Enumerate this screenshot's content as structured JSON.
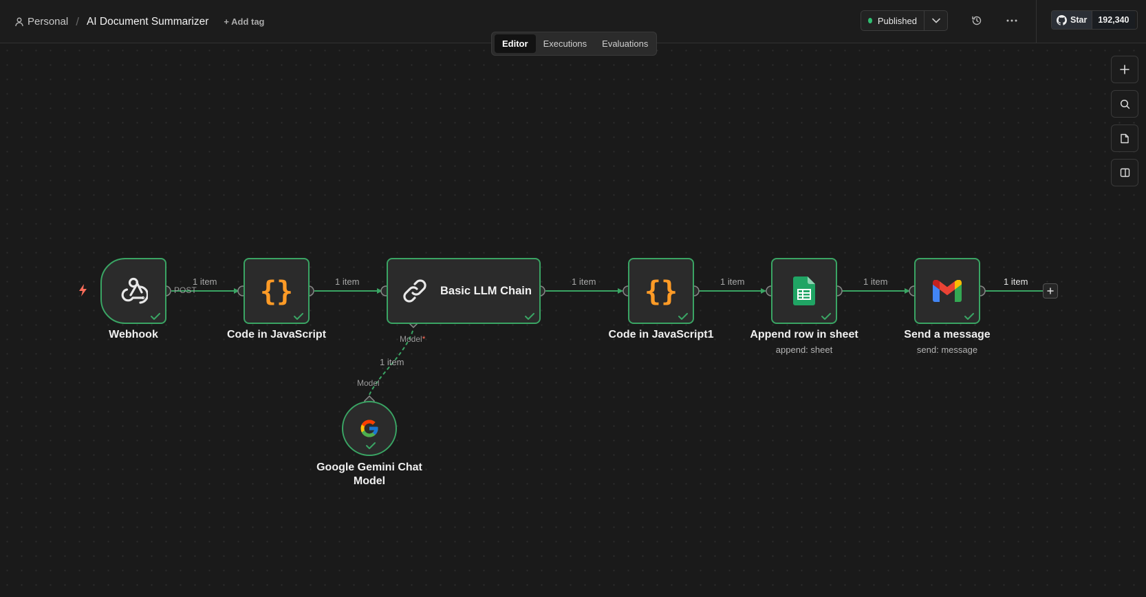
{
  "header": {
    "project": "Personal",
    "separator": "/",
    "workflow_name": "AI Document Summarizer",
    "add_tag": "+ Add tag",
    "publish_status": "Published",
    "status_color": "#2fbf71"
  },
  "tabs": [
    {
      "label": "Editor",
      "active": true
    },
    {
      "label": "Executions",
      "active": false
    },
    {
      "label": "Evaluations",
      "active": false
    }
  ],
  "github": {
    "star_label": "Star",
    "star_count": "192,340"
  },
  "canvas_controls": [
    "zoom-in-icon",
    "search-icon",
    "sticky-note-icon",
    "panel-toggle-icon"
  ],
  "nodes": {
    "webhook": {
      "label": "Webhook",
      "output_label": "POST",
      "icon": "webhook-icon"
    },
    "code1": {
      "label": "Code in JavaScript",
      "icon": "code-braces-icon"
    },
    "llm": {
      "label": "Basic LLM Chain",
      "icon": "link-icon",
      "port_label": "Model",
      "required_mark": "*"
    },
    "gemini": {
      "label_line1": "Google Gemini Chat",
      "label_line2": "Model",
      "port_label": "Model",
      "icon": "google-icon"
    },
    "code2": {
      "label": "Code in JavaScript1",
      "icon": "code-braces-icon"
    },
    "sheet": {
      "label": "Append row in sheet",
      "subtitle": "append: sheet",
      "icon": "google-sheets-icon"
    },
    "gmail": {
      "label": "Send a message",
      "subtitle": "send: message",
      "icon": "gmail-icon"
    }
  },
  "edges": {
    "e1": "1 item",
    "e2": "1 item",
    "e3": "1 item",
    "e4": "1 item",
    "e5": "1 item",
    "e6": "1 item",
    "e7": "1 item",
    "model_edge": "1 item"
  },
  "colors": {
    "success": "#3aa564",
    "accent_trigger": "#ff6d5a",
    "code": "#ff9b26",
    "canvas": "#1a1a1a"
  }
}
